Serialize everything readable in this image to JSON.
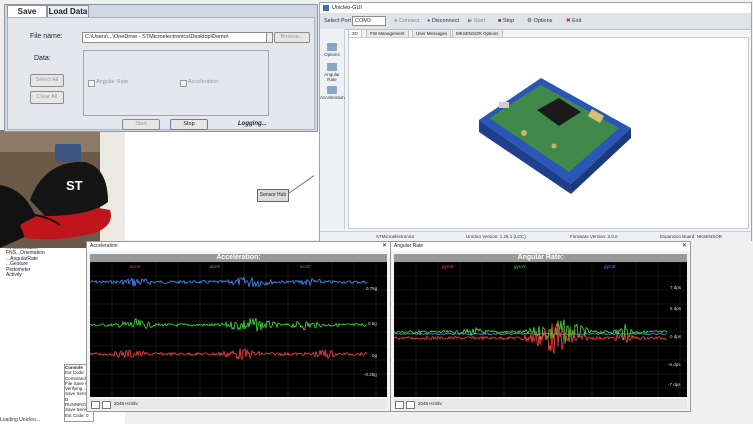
{
  "save_panel": {
    "tabs": [
      "Save Data",
      "Load Data"
    ],
    "file_label": "File name:",
    "file_path": "C:\\Users\\...\\OneDrive - STMicroelectronics\\Desktop\\Demo\\",
    "browse_label": "Browse...",
    "data_label": "Data:",
    "select_all": "Select All",
    "clear_all": "Clear All",
    "opt_angular": "Angular Rate",
    "opt_accel": "Acceleration",
    "start_label": "Start",
    "stop_label": "Stop",
    "logging": "Logging..."
  },
  "app": {
    "title": "Unicleo-GUI",
    "toolbar": {
      "port_label": "Select Port",
      "port_value": "COM3",
      "connect": "Connect",
      "disconnect": "Disconnect",
      "start": "Start",
      "stop": "Stop",
      "options": "Options",
      "exit": "Exit"
    },
    "sidebar": [
      "Options",
      "Angular Rate",
      "Acceleration"
    ],
    "view_tabs": [
      "3D",
      "FW Management",
      "User Messages",
      "MKSENSOR Options"
    ],
    "status": {
      "company": "STMicroelectronics",
      "version": "Unicleo Version: 1.26.1 (LGC)",
      "firmware": "Firmware Version: 3.0.0",
      "board": "Expansion Board: NKSENSOR"
    }
  },
  "accel_window": {
    "title": "Acceleration",
    "plot_title": "Acceleration:",
    "legend": [
      "accX",
      "accY",
      "accZ"
    ],
    "y_ticks": [
      "0.75g",
      "0.5g",
      "0g",
      "-0.25g"
    ],
    "footer_value": "2048 Hz/div"
  },
  "gyro_window": {
    "title": "Angular Rate",
    "plot_title": "Angular Rate:",
    "legend": [
      "gyroX",
      "gyroY",
      "gyroZ"
    ],
    "y_ticks": [
      "7 dps",
      "6 dps",
      "0 dps",
      "-6 dps",
      "-7 dps"
    ],
    "footer_value": "2048 Hz/div"
  },
  "node_label": "Sensor Hub",
  "tree": [
    "...Acceleration",
    "FNS...Orientation",
    "...AngularRate",
    "...Gesture",
    "Pedometer",
    "Activity"
  ],
  "console_lines": [
    "Console",
    "Ext Code: 0",
    "Command O",
    "File Save Ok",
    "Verifying...",
    "Save Sensor D",
    "RUNNING P",
    "Save Sensor",
    "Ext Code: 0"
  ],
  "status_line": "Loading Unicleo..."
}
